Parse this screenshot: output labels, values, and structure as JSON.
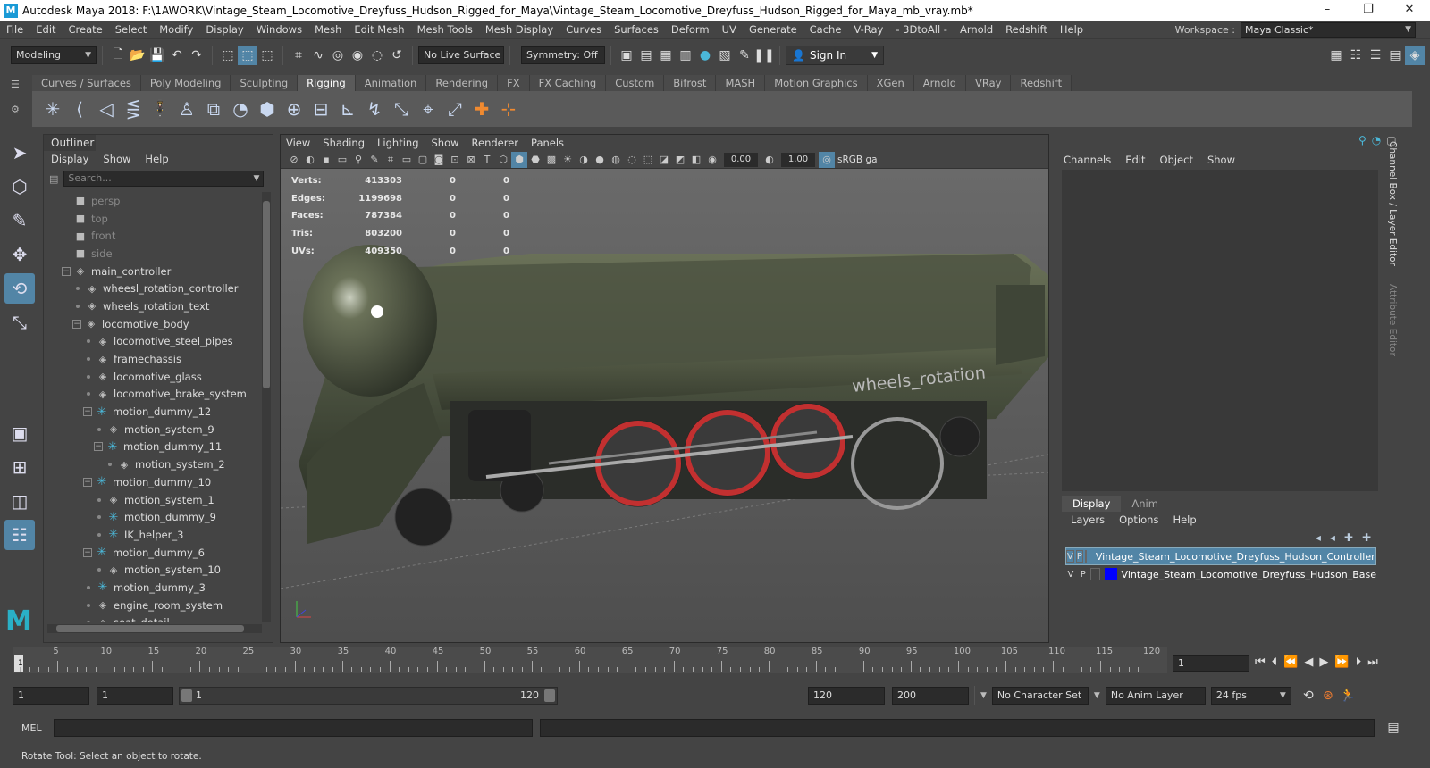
{
  "title": "Autodesk Maya 2018: F:\\1AWORK\\Vintage_Steam_Locomotive_Dreyfuss_Hudson_Rigged_for_Maya\\Vintage_Steam_Locomotive_Dreyfuss_Hudson_Rigged_for_Maya_mb_vray.mb*",
  "menubar": [
    "File",
    "Edit",
    "Create",
    "Select",
    "Modify",
    "Display",
    "Windows",
    "Mesh",
    "Edit Mesh",
    "Mesh Tools",
    "Mesh Display",
    "Curves",
    "Surfaces",
    "Deform",
    "UV",
    "Generate",
    "Cache",
    "V-Ray",
    "- 3DtoAll -",
    "Arnold",
    "Redshift",
    "Help"
  ],
  "workspace": {
    "label": "Workspace :",
    "value": "Maya Classic*"
  },
  "status": {
    "mode": "Modeling",
    "live_surface": "No Live Surface",
    "symmetry": "Symmetry: Off",
    "sign_in": "Sign In"
  },
  "shelf_tabs": [
    "Curves / Surfaces",
    "Poly Modeling",
    "Sculpting",
    "Rigging",
    "Animation",
    "Rendering",
    "FX",
    "FX Caching",
    "Custom",
    "Bifrost",
    "MASH",
    "Motion Graphics",
    "XGen",
    "Arnold",
    "VRay",
    "Redshift"
  ],
  "shelf_active": "Rigging",
  "outliner": {
    "title": "Outliner",
    "menu": [
      "Display",
      "Show",
      "Help"
    ],
    "search_placeholder": "Search...",
    "items": [
      {
        "label": "persp",
        "depth": 0,
        "icon": "camera",
        "dim": true
      },
      {
        "label": "top",
        "depth": 0,
        "icon": "camera",
        "dim": true
      },
      {
        "label": "front",
        "depth": 0,
        "icon": "camera",
        "dim": true
      },
      {
        "label": "side",
        "depth": 0,
        "icon": "camera",
        "dim": true
      },
      {
        "label": "main_controller",
        "depth": 0,
        "icon": "transform",
        "exp": "-"
      },
      {
        "label": "wheesl_rotation_controller",
        "depth": 1,
        "icon": "transform"
      },
      {
        "label": "wheels_rotation_text",
        "depth": 1,
        "icon": "transform"
      },
      {
        "label": "locomotive_body",
        "depth": 1,
        "icon": "transform",
        "exp": "-"
      },
      {
        "label": "locomotive_steel_pipes",
        "depth": 2,
        "icon": "transform"
      },
      {
        "label": "framechassis",
        "depth": 2,
        "icon": "transform"
      },
      {
        "label": "locomotive_glass",
        "depth": 2,
        "icon": "transform"
      },
      {
        "label": "locomotive_brake_system",
        "depth": 2,
        "icon": "transform"
      },
      {
        "label": "motion_dummy_12",
        "depth": 2,
        "icon": "star",
        "exp": "-"
      },
      {
        "label": "motion_system_9",
        "depth": 3,
        "icon": "transform"
      },
      {
        "label": "motion_dummy_11",
        "depth": 3,
        "icon": "star",
        "exp": "-"
      },
      {
        "label": "motion_system_2",
        "depth": 4,
        "icon": "transform"
      },
      {
        "label": "motion_dummy_10",
        "depth": 2,
        "icon": "star",
        "exp": "-"
      },
      {
        "label": "motion_system_1",
        "depth": 3,
        "icon": "transform"
      },
      {
        "label": "motion_dummy_9",
        "depth": 3,
        "icon": "star"
      },
      {
        "label": "IK_helper_3",
        "depth": 3,
        "icon": "star"
      },
      {
        "label": "motion_dummy_6",
        "depth": 2,
        "icon": "star",
        "exp": "-"
      },
      {
        "label": "motion_system_10",
        "depth": 3,
        "icon": "transform"
      },
      {
        "label": "motion_dummy_3",
        "depth": 2,
        "icon": "star"
      },
      {
        "label": "engine_room_system",
        "depth": 2,
        "icon": "transform"
      },
      {
        "label": "seat_detail",
        "depth": 2,
        "icon": "transform"
      }
    ]
  },
  "viewport": {
    "menu": [
      "View",
      "Shading",
      "Lighting",
      "Show",
      "Renderer",
      "Panels"
    ],
    "exposure": "0.00",
    "gamma": "1.00",
    "colorspace": "sRGB ga",
    "camera": "persp",
    "hud": [
      {
        "label": "Verts:",
        "v1": "413303",
        "v2": "0",
        "v3": "0"
      },
      {
        "label": "Edges:",
        "v1": "1199698",
        "v2": "0",
        "v3": "0"
      },
      {
        "label": "Faces:",
        "v1": "787384",
        "v2": "0",
        "v3": "0"
      },
      {
        "label": "Tris:",
        "v1": "803200",
        "v2": "0",
        "v3": "0"
      },
      {
        "label": "UVs:",
        "v1": "409350",
        "v2": "0",
        "v3": "0"
      }
    ],
    "scene_text": "wheels_rotation"
  },
  "channel_box": {
    "menu": [
      "Channels",
      "Edit",
      "Object",
      "Show"
    ],
    "side_tabs": [
      "Channel Box / Layer Editor",
      "Attribute Editor"
    ]
  },
  "layers": {
    "tabs": [
      "Display",
      "Anim"
    ],
    "menu": [
      "Layers",
      "Options",
      "Help"
    ],
    "rows": [
      {
        "v": "V",
        "p": "P",
        "color": "#ff0000",
        "name": "Vintage_Steam_Locomotive_Dreyfuss_Hudson_Controllers",
        "selected": true
      },
      {
        "v": "V",
        "p": "P",
        "color": "#0000ff",
        "name": "Vintage_Steam_Locomotive_Dreyfuss_Hudson_Base",
        "selected": false
      }
    ]
  },
  "timeline": {
    "labels": [
      "5",
      "10",
      "15",
      "20",
      "25",
      "30",
      "35",
      "40",
      "45",
      "50",
      "55",
      "60",
      "65",
      "70",
      "75",
      "80",
      "85",
      "90",
      "95",
      "100",
      "105",
      "110",
      "115",
      "120"
    ],
    "start_label": "1",
    "current_frame": "1"
  },
  "range": {
    "start": "1",
    "inner_start": "1",
    "slider_start": "1",
    "slider_end": "120",
    "end": "120",
    "outer_end": "200",
    "character_set": "No Character Set",
    "anim_layer": "No Anim Layer",
    "fps": "24 fps"
  },
  "mel": {
    "label": "MEL"
  },
  "help_text": "Rotate Tool: Select an object to rotate."
}
